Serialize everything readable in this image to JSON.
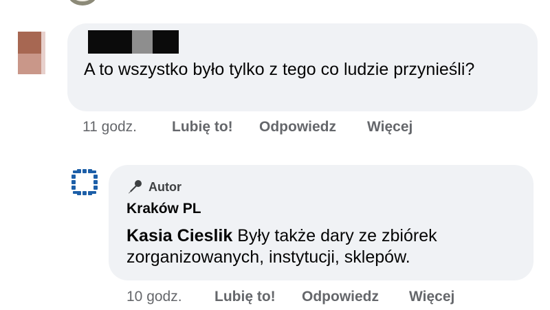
{
  "comment_1": {
    "text": "A to wszystko było tylko z tego co ludzie przynieśli?",
    "time": "11 godz.",
    "like_label": "Lubię to!",
    "reply_label": "Odpowiedz",
    "more_label": "Więcej"
  },
  "reply_1": {
    "badge_label": "Autor",
    "page_name": "Kraków PL",
    "mention": "Kasia Cieslik",
    "text": " Były także dary ze zbiórek zorganizowanych, instytucji, sklepów.",
    "time": "10 godz.",
    "like_label": "Lubię to!",
    "reply_label": "Odpowiedz",
    "more_label": "Więcej",
    "icons": {
      "badge": "microphone-icon",
      "avatar": "krakow-logo-icon"
    },
    "logo_color": "#1d5fa8"
  }
}
